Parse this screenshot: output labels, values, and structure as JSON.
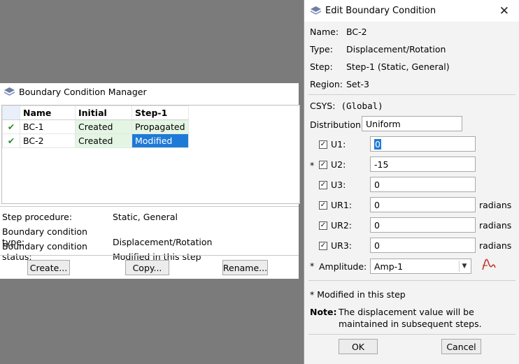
{
  "manager": {
    "title": "Boundary Condition Manager",
    "columns": [
      "Name",
      "Initial",
      "Step-1"
    ],
    "rows": [
      {
        "check": "✔",
        "name": "BC-1",
        "initial": "Created",
        "step1": "Propagated"
      },
      {
        "check": "✔",
        "name": "BC-2",
        "initial": "Created",
        "step1": "Modified"
      }
    ],
    "info": [
      {
        "label": "Step procedure:",
        "value": "Static, General"
      },
      {
        "label": "Boundary condition type:",
        "value": "Displacement/Rotation"
      },
      {
        "label": "Boundary condition status:",
        "value": "Modified in this step"
      }
    ],
    "buttons": {
      "create": "Create...",
      "copy": "Copy...",
      "rename": "Rename..."
    }
  },
  "dialog": {
    "title": "Edit Boundary Condition",
    "close": "✕",
    "name_label": "Name:",
    "name_value": "BC-2",
    "type_label": "Type:",
    "type_value": "Displacement/Rotation",
    "step_label": "Step:",
    "step_value": "Step-1 (Static, General)",
    "region_label": "Region:",
    "region_value": "Set-3",
    "csys_label": "CSYS:",
    "csys_value": "(Global)",
    "distribution_label": "Distribution:",
    "distribution_value": "Uniform",
    "dofs": [
      {
        "label": "U1:",
        "value": "0",
        "checked": "✓",
        "modified": "",
        "unit": ""
      },
      {
        "label": "U2:",
        "value": "-15",
        "checked": "✓",
        "modified": "*",
        "unit": ""
      },
      {
        "label": "U3:",
        "value": "0",
        "checked": "✓",
        "modified": "",
        "unit": ""
      },
      {
        "label": "UR1:",
        "value": "0",
        "checked": "✓",
        "modified": "",
        "unit": "radians"
      },
      {
        "label": "UR2:",
        "value": "0",
        "checked": "✓",
        "modified": "",
        "unit": "radians"
      },
      {
        "label": "UR3:",
        "value": "0",
        "checked": "✓",
        "modified": "",
        "unit": "radians"
      }
    ],
    "amplitude_star": "*",
    "amplitude_label": "Amplitude:",
    "amplitude_value": "Amp-1",
    "modified_note": "* Modified in this step",
    "note_label": "Note:",
    "note_line1": "The displacement value will be",
    "note_line2": "maintained in subsequent steps.",
    "ok": "OK",
    "cancel": "Cancel"
  },
  "colors": {
    "selection": "#1e7ad6",
    "green_cell": "#e4f5e4",
    "check": "#2e8b2e",
    "amp_icon": "#c0392b"
  },
  "icons": {
    "app": "abaqus-app-icon",
    "amplitude": "amplitude-wave-icon",
    "close": "close-icon"
  }
}
